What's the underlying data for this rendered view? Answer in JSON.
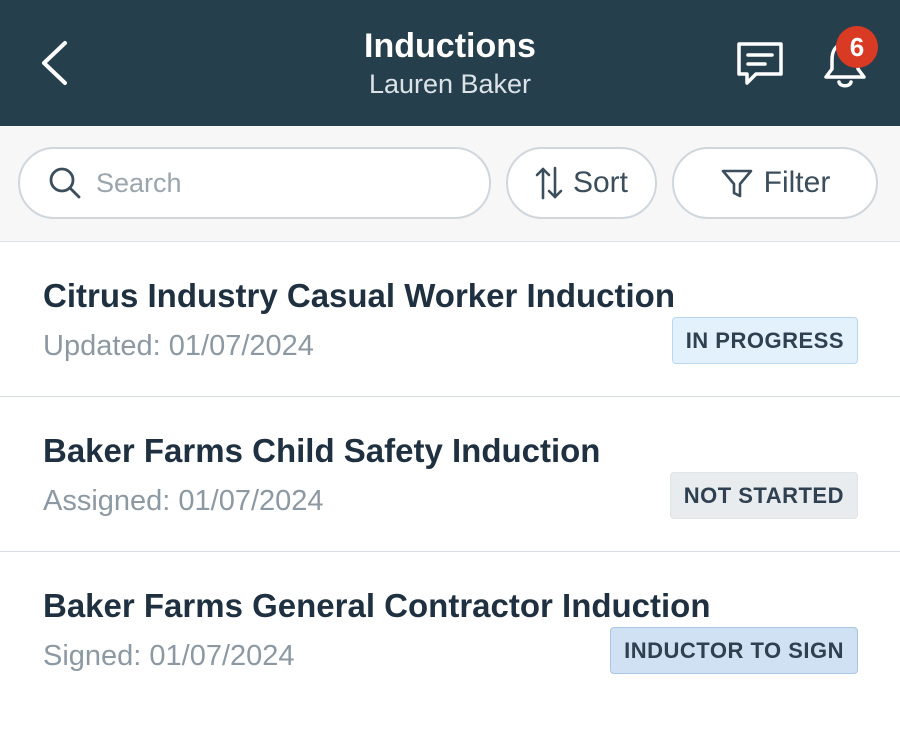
{
  "header": {
    "title": "Inductions",
    "subtitle": "Lauren Baker",
    "notification_count": "6",
    "icons": [
      "chevron-left-icon",
      "chat-icon",
      "bell-icon"
    ],
    "background_color": "#263f4d",
    "badge_color": "#d93a24"
  },
  "toolbar": {
    "search_placeholder": "Search",
    "search_value": "",
    "sort_label": "Sort",
    "filter_label": "Filter",
    "icons": [
      "search-icon",
      "sort-icon",
      "filter-icon"
    ]
  },
  "inductions": [
    {
      "title": "Citrus Industry Casual Worker Induction",
      "date": "Updated: 01/07/2024",
      "status": "IN PROGRESS"
    },
    {
      "title": "Baker Farms Child Safety Induction",
      "date": "Assigned: 01/07/2024",
      "status": "NOT STARTED"
    },
    {
      "title": "Baker Farms General Contractor Induction",
      "date": "Signed: 01/07/2024",
      "status": "INDUCTOR TO SIGN"
    }
  ]
}
